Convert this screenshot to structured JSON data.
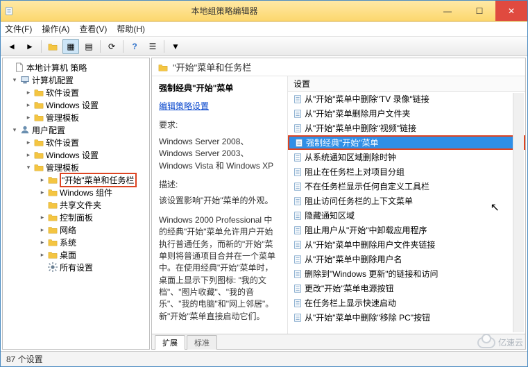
{
  "window": {
    "title": "本地组策略编辑器",
    "menus": [
      "文件(F)",
      "操作(A)",
      "查看(V)",
      "帮助(H)"
    ]
  },
  "tree": {
    "root": "本地计算机 策略",
    "computer": {
      "label": "计算机配置",
      "children": [
        "软件设置",
        "Windows 设置",
        "管理模板"
      ]
    },
    "user": {
      "label": "用户配置",
      "software": "软件设置",
      "windows": "Windows 设置",
      "admin": {
        "label": "管理模板",
        "start": "\"开始\"菜单和任务栏",
        "wincomp": "Windows 组件",
        "shared": "共享文件夹",
        "cp": "控制面板",
        "net": "网络",
        "sys": "系统",
        "desktop": "桌面",
        "allset": "所有设置"
      }
    }
  },
  "header": {
    "title": "\"开始\"菜单和任务栏"
  },
  "detail": {
    "title": "强制经典\"开始\"菜单",
    "editlink": "编辑策略设置",
    "reqLabel": "要求:",
    "reqBody": "Windows Server 2008、Windows Server 2003、Windows Vista 和 Windows XP",
    "descLabel": "描述:",
    "descBody1": "该设置影响\"开始\"菜单的外观。",
    "descBody2": "Windows 2000 Professional 中的经典\"开始\"菜单允许用户开始执行普通任务，而新的\"开始\"菜单则将普通项目合并在一个菜单中。在使用经典\"开始\"菜单时，桌面上显示下列图标: \"我的文档\"、\"图片收藏\"、\"我的音乐\"、\"我的电脑\"和\"网上邻居\"。新\"开始\"菜单直接启动它们。"
  },
  "list": {
    "colSetting": "设置",
    "items": [
      "从\"开始\"菜单中删除\"TV 录像\"链接",
      "从\"开始\"菜单删除用户文件夹",
      "从\"开始\"菜单中删除\"视频\"链接",
      "强制经典\"开始\"菜单",
      "从系统通知区域删除时钟",
      "阻止在任务栏上对项目分组",
      "不在任务栏显示任何自定义工具栏",
      "阻止访问任务栏的上下文菜单",
      "隐藏通知区域",
      "阻止用户从\"开始\"中卸载应用程序",
      "从\"开始\"菜单中删除用户文件夹链接",
      "从\"开始\"菜单中删除用户名",
      "删除到\"Windows 更新\"的链接和访问",
      "更改\"开始\"菜单电源按钮",
      "在任务栏上显示快速启动",
      "从\"开始\"菜单中删除\"移除 PC\"按钮"
    ],
    "selectedIndex": 3
  },
  "tabs": {
    "extended": "扩展",
    "standard": "标准"
  },
  "status": {
    "text": "87 个设置"
  },
  "watermark": "亿速云"
}
